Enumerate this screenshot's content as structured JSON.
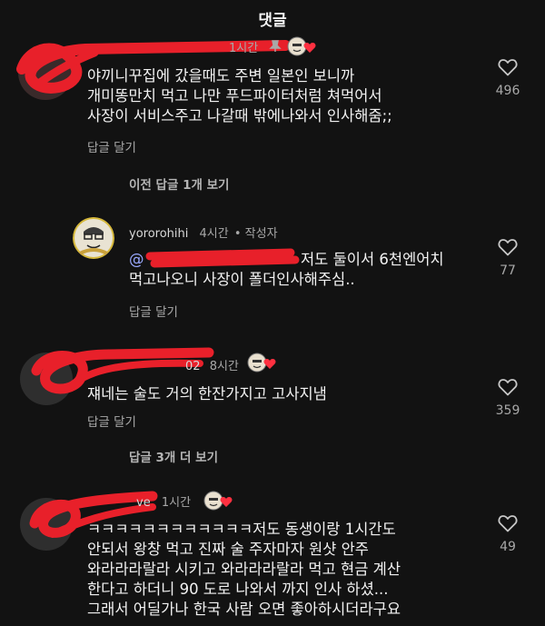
{
  "header": {
    "title": "댓글"
  },
  "comments": [
    {
      "time": "1시간",
      "lines": [
        "야끼니꾸집에 갔을때도 주변 일본인 보니까",
        "개미똥만치 먹고 나만 푸드파이터처럼 쳐먹어서",
        "사장이 서비스주고 나갈때 밖에나와서 인사해줌;;"
      ],
      "reply_label": "답글 달기",
      "likes": "496"
    },
    {
      "more_label": "이전 답글 1개 보기"
    },
    {
      "username": "yororohihi",
      "time": "4시간",
      "author_tag": "• 작성자",
      "mention": "@",
      "lines": [
        "저도 둘이서 6천엔어치",
        "먹고나오니 사장이 폴더인사해주심.."
      ],
      "reply_label": "답글 달기",
      "likes": "77"
    },
    {
      "username_suffix": "02",
      "time": "8시간",
      "lines": [
        "쟤네는 술도 거의 한잔가지고 고사지냄"
      ],
      "reply_label": "답글 달기",
      "likes": "359",
      "more_label": "답글 3개 더 보기"
    },
    {
      "username_suffix": "ve",
      "time": "1시간",
      "lines": [
        "ㅋㅋㅋㅋㅋㅋㅋㅋㅋㅋㅋㅋ저도 동생이랑 1시간도",
        "안되서 왕창 먹고 진짜 술 주자마자 원샷 안주",
        "와라라라랄라 시키고 와라라라랄라 먹고 현금 계산",
        "한다고 하더니 90 도로 나와서 까지 인사 하셨...",
        "그래서 어딜가나 한국 사람 오면 좋아하시더라구요"
      ],
      "likes": "49"
    }
  ],
  "colors": {
    "background": "#121212",
    "text": "#f2f2f2",
    "muted": "#a8a8a8",
    "mention": "#9aa9ff",
    "redaction": "#e8202a",
    "heart": "#ff3040"
  },
  "icons": [
    "heart-outline-icon",
    "pin-icon",
    "creator-avatar-icon",
    "red-heart-icon"
  ]
}
